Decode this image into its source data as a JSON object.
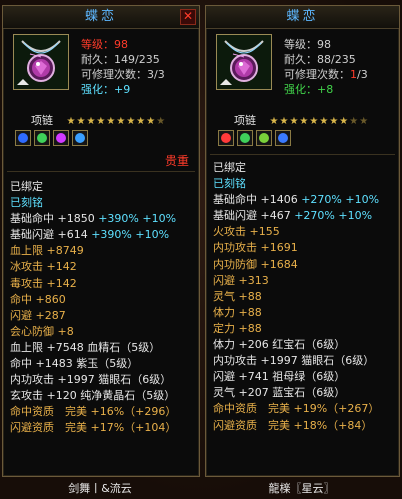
{
  "left": {
    "title": "蝶恋",
    "level": "等级：98",
    "durability": "耐久：149/235",
    "repair": "可修理次数：3/3",
    "enhance_label": "强化：",
    "enhance_value": "+9",
    "type_label": "项链",
    "stars": 9,
    "stars_total": 10,
    "gems": [
      "#2f6bff",
      "#3fd15a",
      "#d23aff",
      "#3aa0ff"
    ],
    "quality": "贵重",
    "bound": "已绑定",
    "engraved": "已刻铭",
    "attrs": [
      [
        [
          "基础命中 +1850 ",
          "white"
        ],
        [
          "+390% +10%",
          "cyan"
        ]
      ],
      [
        [
          "基础闪避 +614 ",
          "white"
        ],
        [
          "+390% +10%",
          "cyan"
        ]
      ],
      [
        [
          "血上限 +8749",
          "orange"
        ]
      ],
      [
        [
          "冰攻击 +142",
          "orange"
        ]
      ],
      [
        [
          "毒攻击 +142",
          "orange"
        ]
      ],
      [
        [
          "命中 +860",
          "orange"
        ]
      ],
      [
        [
          "闪避 +287",
          "orange"
        ]
      ],
      [
        [
          "会心防御 +8",
          "orange"
        ]
      ],
      [
        [
          "血上限 +7548 血精石（5级）",
          "white"
        ]
      ],
      [
        [
          "命中 +1483 紫玉（5级）",
          "white"
        ]
      ],
      [
        [
          "内功攻击 +1997 猫眼石（6级）",
          "white"
        ]
      ],
      [
        [
          "玄攻击 +120 纯净黄晶石（5级）",
          "white"
        ]
      ],
      [
        [
          "命中资质　完美 +16%（+296）",
          "orange"
        ]
      ],
      [
        [
          "闪避资质　完美 +17%（+104）",
          "orange"
        ]
      ]
    ],
    "footer": "剑舞丨&流云"
  },
  "right": {
    "title": "蝶恋",
    "level": "等级：98",
    "durability": "耐久：88/235",
    "repair_label": "可修理次数：",
    "repair_cur": "1",
    "repair_total": "/3",
    "enhance_label": "强化：",
    "enhance_value": "+8",
    "type_label": "项链",
    "stars": 8,
    "stars_total": 10,
    "gems": [
      "#ff3a3a",
      "#3fd15a",
      "#7ad13a",
      "#3a7aff"
    ],
    "bound": "已绑定",
    "engraved": "已刻铭",
    "attrs": [
      [
        [
          "基础命中 +1406 ",
          "white"
        ],
        [
          "+270% +10%",
          "cyan"
        ]
      ],
      [
        [
          "基础闪避 +467 ",
          "white"
        ],
        [
          "+270% +10%",
          "cyan"
        ]
      ],
      [
        [
          "火攻击 +155",
          "orange"
        ]
      ],
      [
        [
          "内功攻击 +1691",
          "orange"
        ]
      ],
      [
        [
          "内功防御 +1684",
          "orange"
        ]
      ],
      [
        [
          "闪避 +313",
          "orange"
        ]
      ],
      [
        [
          "灵气 +88",
          "orange"
        ]
      ],
      [
        [
          "体力 +88",
          "orange"
        ]
      ],
      [
        [
          "定力 +88",
          "orange"
        ]
      ],
      [
        [
          "体力 +206 红宝石（6级）",
          "white"
        ]
      ],
      [
        [
          "内功攻击 +1997 猫眼石（6级）",
          "white"
        ]
      ],
      [
        [
          "闪避 +741 祖母绿（6级）",
          "white"
        ]
      ],
      [
        [
          "灵气 +207 蓝宝石（6级）",
          "white"
        ]
      ],
      [
        [
          "命中资质　完美 +19%（+267）",
          "orange"
        ]
      ],
      [
        [
          "闪避资质　完美 +18%（+84）",
          "orange"
        ]
      ]
    ],
    "footer": "龍檪〖星云〗"
  },
  "colors": {
    "title": "#5db7ff",
    "red": "#ff3b2a",
    "cyan": "#5ee0ff",
    "green": "#41d34a",
    "gold": "#ffd85a",
    "orange": "#e8b04a",
    "white": "#e6e6e6",
    "frame": "#6b5a3a"
  },
  "icons": {
    "close": "close-icon",
    "item": "necklace-icon",
    "star": "star-icon",
    "gem": "gem-slot-icon"
  }
}
